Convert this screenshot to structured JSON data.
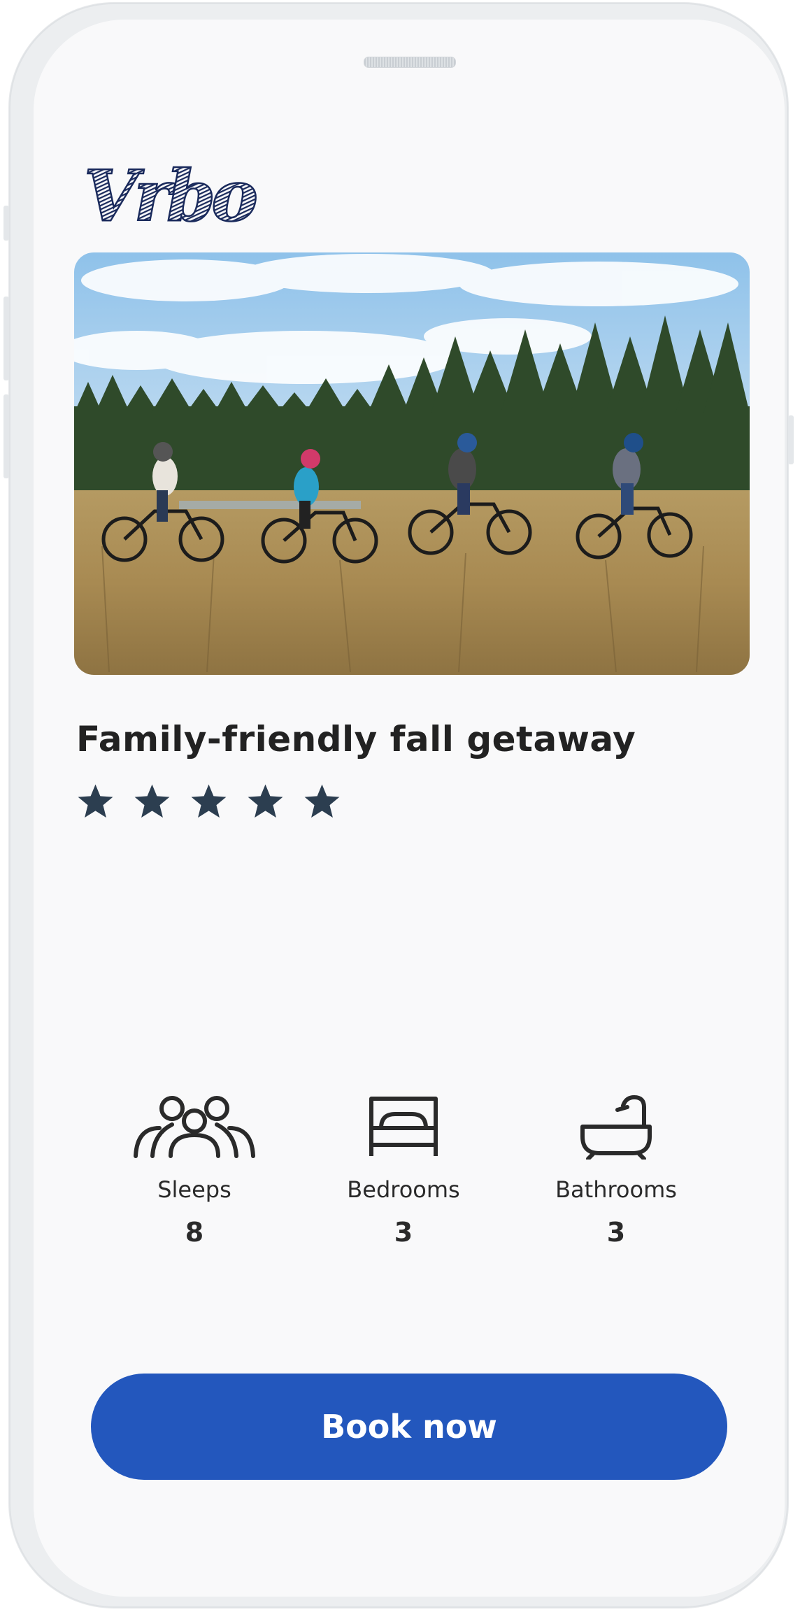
{
  "brand": {
    "logo_text": "Vrbo",
    "logo_color": "#1a2a5c"
  },
  "listing": {
    "title": "Family-friendly fall getaway",
    "rating": 5,
    "rating_max": 5,
    "star_color": "#2c3e50"
  },
  "amenities": [
    {
      "icon": "people-icon",
      "label": "Sleeps",
      "value": "8"
    },
    {
      "icon": "bed-icon",
      "label": "Bedrooms",
      "value": "3"
    },
    {
      "icon": "bathtub-icon",
      "label": "Bathrooms",
      "value": "3"
    }
  ],
  "cta": {
    "label": "Book now",
    "color": "#2357bd"
  }
}
